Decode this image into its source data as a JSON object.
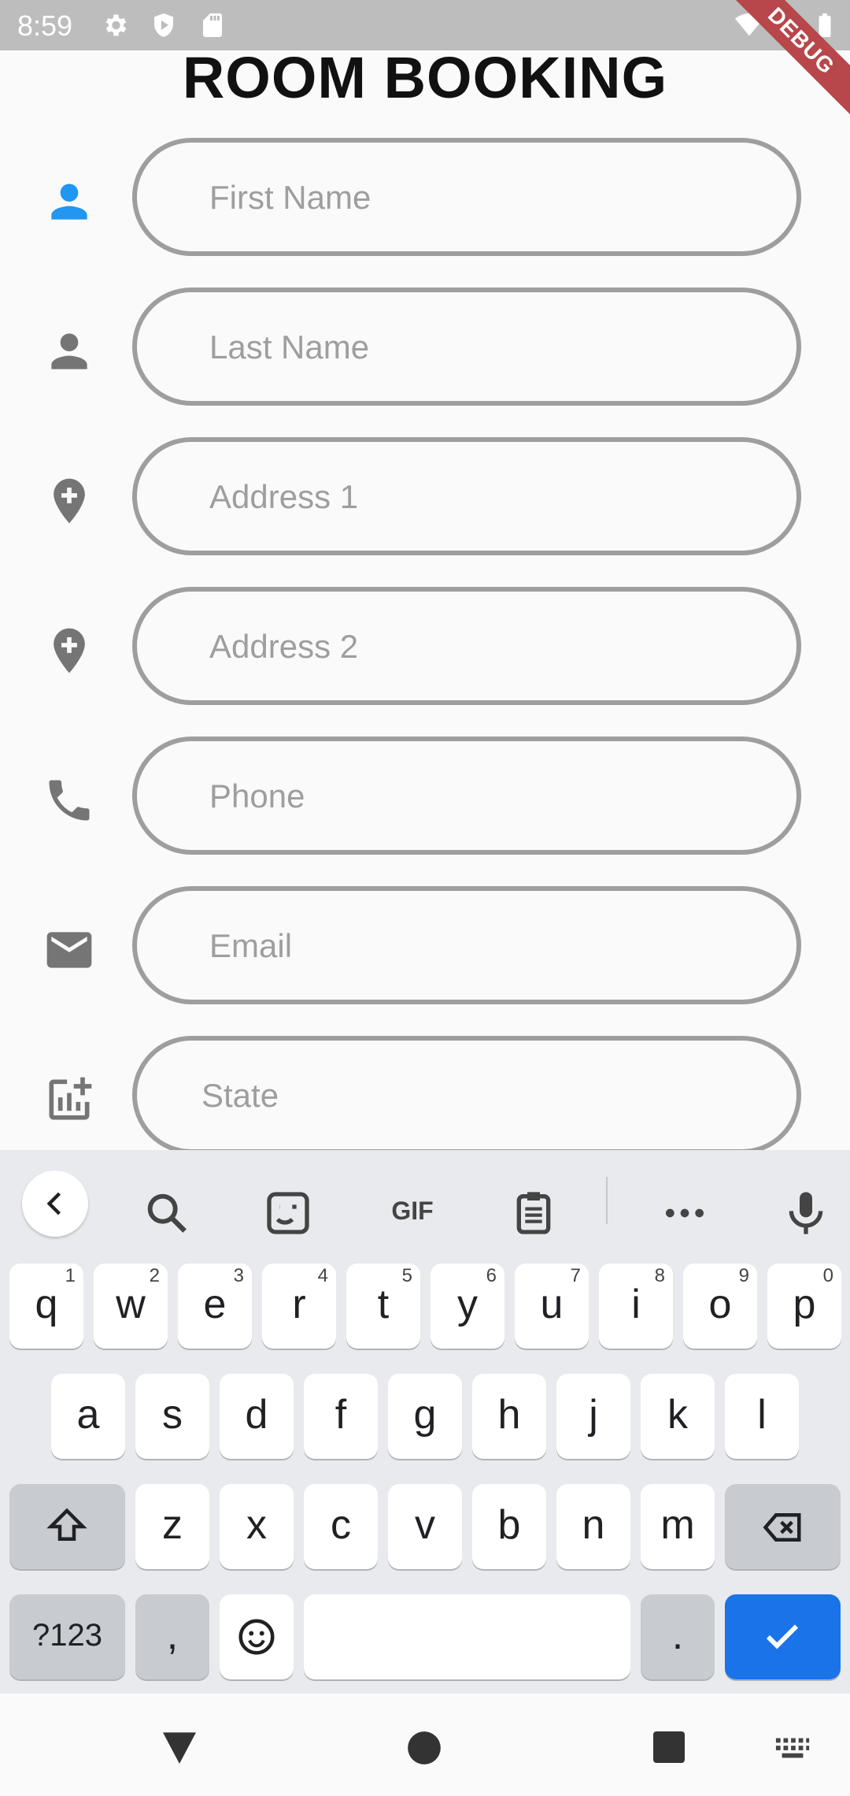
{
  "status_bar": {
    "time": "8:59",
    "icons": [
      "gear-icon",
      "shield-icon",
      "sd-card-icon",
      "wifi-icon",
      "signal-icon",
      "battery-icon"
    ],
    "debug_banner": "DEBUG"
  },
  "page": {
    "title": "ROOM BOOKING"
  },
  "form": {
    "fields": [
      {
        "placeholder": "First Name",
        "icon": "person-icon",
        "focused": true
      },
      {
        "placeholder": "Last Name",
        "icon": "person-icon"
      },
      {
        "placeholder": "Address 1",
        "icon": "add-location-icon"
      },
      {
        "placeholder": "Address 2",
        "icon": "add-location-icon"
      },
      {
        "placeholder": "Phone",
        "icon": "phone-icon"
      },
      {
        "placeholder": "Email",
        "icon": "email-icon"
      },
      {
        "placeholder": "State",
        "icon": "add-chart-icon"
      }
    ]
  },
  "colors": {
    "accent": "#2196f3",
    "field_border": "#9e9e9e",
    "icon_gray": "#757575",
    "keyboard_bg": "#e8eaed",
    "enter_key": "#1a73e8"
  },
  "keyboard": {
    "toolbar": [
      "back-icon",
      "search-icon",
      "sticker-icon",
      "gif-icon",
      "clipboard-icon",
      "more-icon",
      "mic-icon"
    ],
    "gif_label": "GIF",
    "row1": [
      {
        "k": "q",
        "s": "1"
      },
      {
        "k": "w",
        "s": "2"
      },
      {
        "k": "e",
        "s": "3"
      },
      {
        "k": "r",
        "s": "4"
      },
      {
        "k": "t",
        "s": "5"
      },
      {
        "k": "y",
        "s": "6"
      },
      {
        "k": "u",
        "s": "7"
      },
      {
        "k": "i",
        "s": "8"
      },
      {
        "k": "o",
        "s": "9"
      },
      {
        "k": "p",
        "s": "0"
      }
    ],
    "row2": [
      "a",
      "s",
      "d",
      "f",
      "g",
      "h",
      "j",
      "k",
      "l"
    ],
    "row3": [
      "z",
      "x",
      "c",
      "v",
      "b",
      "n",
      "m"
    ],
    "row4": {
      "symbols": "?123",
      "comma": ",",
      "period": "."
    }
  },
  "nav_bar": {
    "icons": [
      "back-triangle-icon",
      "home-circle-icon",
      "recents-square-icon",
      "keyboard-switch-icon"
    ]
  }
}
